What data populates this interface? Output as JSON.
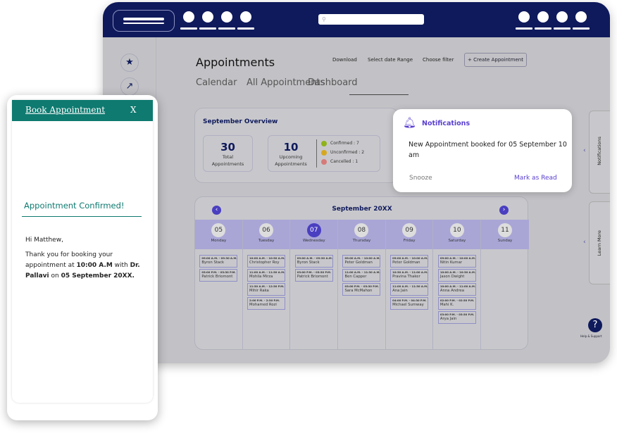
{
  "header": {
    "search_placeholder": "⚲"
  },
  "page": {
    "title": "Appointments",
    "actions": [
      "Download",
      "Select date Range",
      "Choose filter"
    ],
    "create_label": "+ Create Appointment",
    "tabs": [
      "Calendar",
      "All Appointments",
      "Dashboard"
    ],
    "active_tab": 1
  },
  "overview": {
    "title": "September Overview",
    "total": "30",
    "total_label": "Total Appointments",
    "upcoming": "10",
    "upcoming_label": "Upcoming Appointments",
    "legend": [
      {
        "label": "Confirmed : 7",
        "color": "#8fb31a"
      },
      {
        "label": "Unconfirmed : 2",
        "color": "#d6a820"
      },
      {
        "label": "Cancelled : 1",
        "color": "#d77a7a"
      }
    ]
  },
  "calendar": {
    "month": "September 20XX",
    "prev": "‹",
    "next": "›",
    "days": [
      {
        "num": "05",
        "name": "Monday",
        "appts": [
          {
            "time": "09:00 A.M. - 09:30 A.M.",
            "name": "Byron Stack"
          },
          {
            "time": "03:00 P.M. - 03:30 P.M.",
            "name": "Patrick Briomont"
          }
        ]
      },
      {
        "num": "06",
        "name": "Tuesday",
        "appts": [
          {
            "time": "10:00 A.M. - 10:30 A.M.",
            "name": "Christopher Roy"
          },
          {
            "time": "11:00 A.M. - 11:30 A.M.",
            "name": "Mohila Mirza"
          },
          {
            "time": "11:30 A.M. - 12:30 P.M.",
            "name": "Mihir Raka"
          },
          {
            "time": "2:00 P.M. - 2:30 P.M.",
            "name": "Mohamed Rozi"
          }
        ]
      },
      {
        "num": "07",
        "name": "Wednesday",
        "current": true,
        "appts": [
          {
            "time": "09:00 A.M. - 09:30 A.M.",
            "name": "Byron Stack"
          },
          {
            "time": "03:00 P.M. - 03:30 P.M.",
            "name": "Patrick Briomont"
          }
        ]
      },
      {
        "num": "08",
        "name": "Thursday",
        "appts": [
          {
            "time": "09:00 A.M. - 10:00 A.M.",
            "name": "Peter Goldman"
          },
          {
            "time": "11:00 A.M. - 11:30 A.M.",
            "name": "Ben Capper"
          },
          {
            "time": "03:00 P.M. - 03:30 P.M.",
            "name": "Sara McMahon"
          }
        ]
      },
      {
        "num": "09",
        "name": "Friday",
        "appts": [
          {
            "time": "09:00 A.M. - 10:00 A.M.",
            "name": "Peter Goldman"
          },
          {
            "time": "10:30 A.M. - 11:00 A.M.",
            "name": "Pravina Thaker"
          },
          {
            "time": "11:00 A.M. - 11:30 A.M.",
            "name": "Ana Jain"
          },
          {
            "time": "04:00 P.M. - 04:30 P.M.",
            "name": "Michael Sumway"
          }
        ]
      },
      {
        "num": "10",
        "name": "Saturday",
        "appts": [
          {
            "time": "09:00 A.M. - 10:00 A.M.",
            "name": "Nitin Kumar"
          },
          {
            "time": "10:00 A.M. - 10:30 A.M.",
            "name": "Jason Dwight"
          },
          {
            "time": "10:00 A.M. - 11:00 A.M.",
            "name": "Anna Andrea"
          },
          {
            "time": "02:00 P.M. - 02:30 P.M.",
            "name": "Mahi K."
          },
          {
            "time": "03:00 P.M. - 03:30 P.M.",
            "name": "Arya Jain"
          }
        ]
      },
      {
        "num": "11",
        "name": "Sunday",
        "appts": []
      }
    ]
  },
  "side_tabs": {
    "notifications": "Notifications",
    "learn_more": "Learn More",
    "help": "?",
    "help_label": "Help & Support"
  },
  "notification": {
    "title": "Notifications",
    "message": "New Appointment booked for 05 September 10 am",
    "snooze": "Snooze",
    "mark_read": "Mark as Read",
    "accent": "#5a3fd0"
  },
  "phone": {
    "title": "Book Appointment",
    "close": "X",
    "confirmed": "Appointment Confirmed!",
    "greeting": "Hi Matthew,",
    "msg_pre": "Thank you for booking your appointment at ",
    "time": "10:00 A.M",
    "msg_mid": " with ",
    "doctor": "Dr. Pallavi",
    "msg_on": " on ",
    "date": "05 September 20XX.",
    "accent": "#0e7a70"
  }
}
